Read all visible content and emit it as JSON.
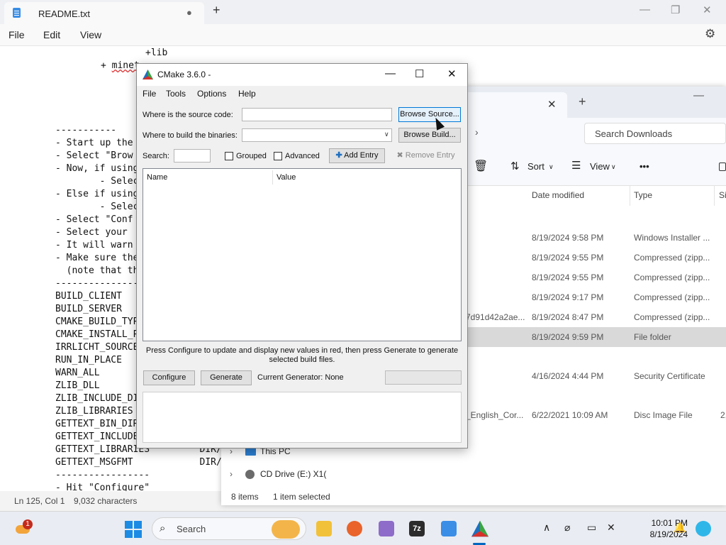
{
  "notepad": {
    "tab_title": "README.txt",
    "unsaved_dot": "●",
    "new_tab": "+",
    "minimize": "—",
    "maximize": "❐",
    "close": "✕",
    "menu": {
      "file": "File",
      "edit": "Edit",
      "view": "View"
    },
    "top_line1": "+lib",
    "top_line2_prefix": "+ ",
    "top_line2_word": "minet",
    "lines": [
      "-----------",
      "- Start up the",
      "- Select \"Brow",
      "- Now, if using",
      "        - Selec",
      "- Else if using",
      "        - Selec",
      "- Select \"Conf",
      "- Select your",
      "- It will warn",
      "- Make sure the",
      "  (note that th",
      "-----------------",
      "BUILD_CLIENT",
      "BUILD_SERVER",
      "CMAKE_BUILD_TYP",
      "CMAKE_INSTALL_P",
      "IRRLICHT_SOURCE",
      "RUN_IN_PLACE",
      "WARN_ALL",
      "ZLIB_DLL",
      "ZLIB_INCLUDE_DI",
      "ZLIB_LIBRARIES",
      "GETTEXT_BIN_DIR",
      "GETTEXT_INCLUDE",
      "GETTEXT_LIBRARIES         DIR/",
      "GETTEXT_MSGFMT            DIR/",
      "-----------------",
      "- Hit \"Configure\""
    ],
    "status": {
      "position": "Ln 125, Col 1",
      "characters": "9,032 characters"
    }
  },
  "explorer": {
    "tab_close": "✕",
    "new_tab": "+",
    "minimize": "—",
    "chevron": "›",
    "search_placeholder": "Search Downloads",
    "toolbar": {
      "sort": "Sort",
      "view": "View",
      "more": "•••"
    },
    "columns": {
      "date": "Date modified",
      "type": "Type",
      "size": "Si"
    },
    "rows": [
      {
        "name": "",
        "date": "8/19/2024 9:58 PM",
        "type": "Windows Installer ...",
        "selected": false
      },
      {
        "name": "",
        "date": "8/19/2024 9:55 PM",
        "type": "Compressed (zipp...",
        "selected": false
      },
      {
        "name": "",
        "date": "8/19/2024 9:55 PM",
        "type": "Compressed (zipp...",
        "selected": false
      },
      {
        "name": "",
        "date": "8/19/2024 9:17 PM",
        "type": "Compressed (zipp...",
        "selected": false
      },
      {
        "name": "7d91d42a2ae...",
        "date": "8/19/2024 8:47 PM",
        "type": "Compressed (zipp...",
        "selected": false
      },
      {
        "name": "",
        "date": "8/19/2024 9:59 PM",
        "type": "File folder",
        "selected": true
      },
      {
        "name": "",
        "date": "4/16/2024 4:44 PM",
        "type": "Security Certificate",
        "selected": false
      },
      {
        "name": "_English_Cor...",
        "date": "6/22/2021 10:09 AM",
        "type": "Disc Image File",
        "size": "2,",
        "selected": false
      }
    ],
    "tree": {
      "this_pc": "This PC",
      "cd_drive": "CD Drive (E:) X1("
    },
    "status": {
      "items": "8 items",
      "selected": "1 item selected"
    }
  },
  "cmake": {
    "title": "CMake 3.6.0 -",
    "minimize": "—",
    "maximize": "☐",
    "close": "✕",
    "menu": {
      "file": "File",
      "tools": "Tools",
      "options": "Options",
      "help": "Help"
    },
    "source_label": "Where is the source code:",
    "source_value": "",
    "browse_source": "Browse Source...",
    "build_label": "Where to build the binaries:",
    "build_value": "",
    "browse_build": "Browse Build...",
    "search_label": "Search:",
    "search_value": "",
    "grouped": "Grouped",
    "advanced": "Advanced",
    "add_entry": "Add Entry",
    "remove_entry": "Remove Entry",
    "col_name": "Name",
    "col_value": "Value",
    "hint": "Press Configure to update and display new values in red, then press Generate to generate selected build files.",
    "configure": "Configure",
    "generate": "Generate",
    "current_generator": "Current Generator: None"
  },
  "taskbar": {
    "search_placeholder": "Search",
    "notification_count": "1",
    "time": "10:01 PM",
    "date": "8/19/2024",
    "chevron_up": "∧"
  }
}
